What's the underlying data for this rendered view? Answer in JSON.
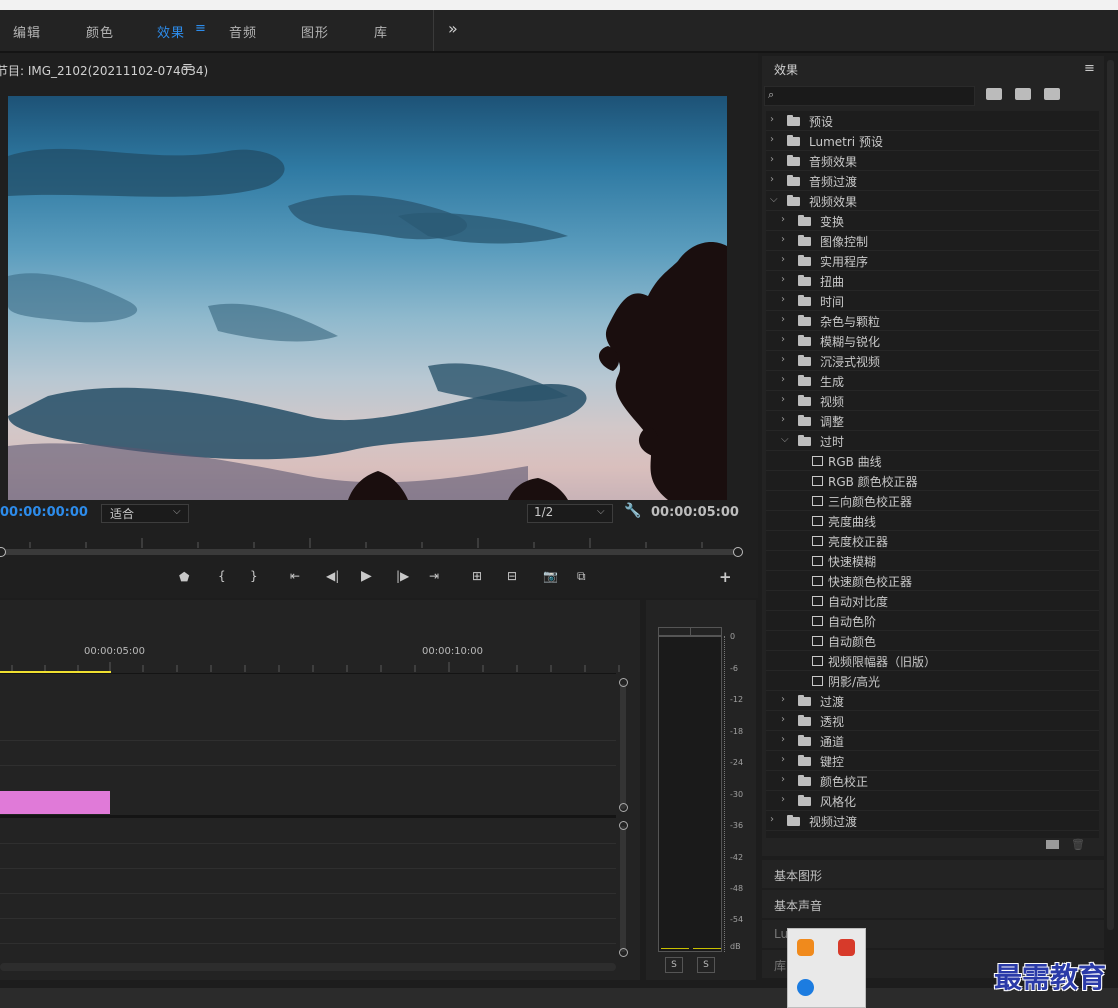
{
  "workspace_tabs": [
    {
      "label": "编辑",
      "active": false
    },
    {
      "label": "颜色",
      "active": false
    },
    {
      "label": "效果",
      "active": true
    },
    {
      "label": "音频",
      "active": false
    },
    {
      "label": "图形",
      "active": false
    },
    {
      "label": "库",
      "active": false
    }
  ],
  "workspace_more": "»",
  "program_monitor": {
    "title": "节目: IMG_2102(20211102-074034)",
    "menu_icon": "hamburger-icon",
    "current_time": "00:00:00:00",
    "zoom_value": "适合",
    "resolution_value": "1/2",
    "duration": "00:00:05:00"
  },
  "timeline": {
    "ruler_labels": [
      "00:00:05:00",
      "00:00:10:00"
    ]
  },
  "audio_meter": {
    "scale": [
      "0",
      "-6",
      "-12",
      "-18",
      "-24",
      "-30",
      "-36",
      "-42",
      "-48",
      "-54",
      "dB"
    ],
    "solo_left": "S",
    "solo_right": "S"
  },
  "effects_panel": {
    "title": "效果",
    "search_placeholder": "",
    "filter_icons": [
      "accelerated-effects-icon",
      "32bit-effects-icon",
      "yuv-effects-icon"
    ],
    "tree": [
      {
        "label": "预设",
        "level": 0,
        "kind": "preset-folder",
        "expanded": false
      },
      {
        "label": "Lumetri 预设",
        "level": 0,
        "kind": "preset-folder",
        "expanded": false
      },
      {
        "label": "音频效果",
        "level": 0,
        "kind": "folder",
        "expanded": false
      },
      {
        "label": "音频过渡",
        "level": 0,
        "kind": "folder",
        "expanded": false
      },
      {
        "label": "视频效果",
        "level": 0,
        "kind": "folder",
        "expanded": true
      },
      {
        "label": "变换",
        "level": 1,
        "kind": "folder",
        "expanded": false
      },
      {
        "label": "图像控制",
        "level": 1,
        "kind": "folder",
        "expanded": false
      },
      {
        "label": "实用程序",
        "level": 1,
        "kind": "folder",
        "expanded": false
      },
      {
        "label": "扭曲",
        "level": 1,
        "kind": "folder",
        "expanded": false
      },
      {
        "label": "时间",
        "level": 1,
        "kind": "folder",
        "expanded": false
      },
      {
        "label": "杂色与颗粒",
        "level": 1,
        "kind": "folder",
        "expanded": false
      },
      {
        "label": "模糊与锐化",
        "level": 1,
        "kind": "folder",
        "expanded": false
      },
      {
        "label": "沉浸式视频",
        "level": 1,
        "kind": "folder",
        "expanded": false
      },
      {
        "label": "生成",
        "level": 1,
        "kind": "folder",
        "expanded": false
      },
      {
        "label": "视频",
        "level": 1,
        "kind": "folder",
        "expanded": false
      },
      {
        "label": "调整",
        "level": 1,
        "kind": "folder",
        "expanded": false
      },
      {
        "label": "过时",
        "level": 1,
        "kind": "folder",
        "expanded": true
      },
      {
        "label": "RGB 曲线",
        "level": 2,
        "kind": "effect"
      },
      {
        "label": "RGB 颜色校正器",
        "level": 2,
        "kind": "effect"
      },
      {
        "label": "三向颜色校正器",
        "level": 2,
        "kind": "effect"
      },
      {
        "label": "亮度曲线",
        "level": 2,
        "kind": "effect"
      },
      {
        "label": "亮度校正器",
        "level": 2,
        "kind": "effect"
      },
      {
        "label": "快速模糊",
        "level": 2,
        "kind": "effect"
      },
      {
        "label": "快速颜色校正器",
        "level": 2,
        "kind": "effect"
      },
      {
        "label": "自动对比度",
        "level": 2,
        "kind": "effect"
      },
      {
        "label": "自动色阶",
        "level": 2,
        "kind": "effect"
      },
      {
        "label": "自动颜色",
        "level": 2,
        "kind": "effect"
      },
      {
        "label": "视频限幅器（旧版）",
        "level": 2,
        "kind": "effect"
      },
      {
        "label": "阴影/高光",
        "level": 2,
        "kind": "effect"
      },
      {
        "label": "过渡",
        "level": 1,
        "kind": "folder",
        "expanded": false
      },
      {
        "label": "透视",
        "level": 1,
        "kind": "folder",
        "expanded": false
      },
      {
        "label": "通道",
        "level": 1,
        "kind": "folder",
        "expanded": false
      },
      {
        "label": "键控",
        "level": 1,
        "kind": "folder",
        "expanded": false
      },
      {
        "label": "颜色校正",
        "level": 1,
        "kind": "folder",
        "expanded": false
      },
      {
        "label": "风格化",
        "level": 1,
        "kind": "folder",
        "expanded": false
      },
      {
        "label": "视频过渡",
        "level": 0,
        "kind": "folder",
        "expanded": false
      }
    ]
  },
  "collapsed_panels": [
    "基本图形",
    "基本声音",
    "Lu",
    "库"
  ],
  "watermark": "最需教育",
  "colors": {
    "accent": "#2d8ceb",
    "playhead": "#f0e030",
    "clip": "#e07ad8"
  }
}
